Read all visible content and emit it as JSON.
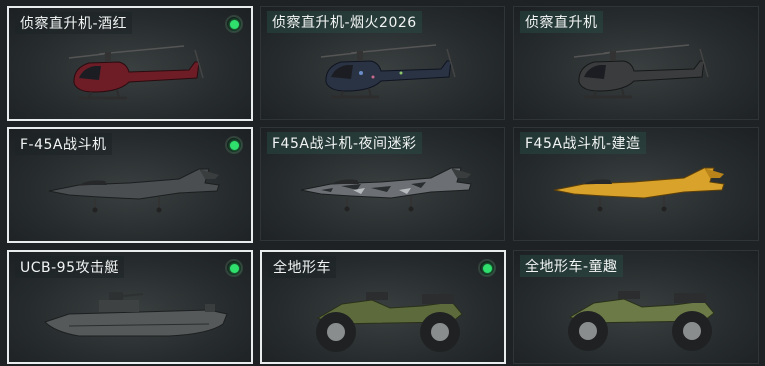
{
  "items": [
    {
      "label": "侦察直升机-酒红",
      "equipped": true,
      "selected": true,
      "kind": "helicopter",
      "color": "#6e1c26"
    },
    {
      "label": "侦察直升机-烟火2026",
      "equipped": false,
      "selected": false,
      "kind": "helicopter",
      "color": "#2a3344"
    },
    {
      "label": "侦察直升机",
      "equipped": false,
      "selected": false,
      "kind": "helicopter",
      "color": "#3a3c3d"
    },
    {
      "label": "F-45A战斗机",
      "equipped": true,
      "selected": true,
      "kind": "jet",
      "color": "#4a4e50"
    },
    {
      "label": "F45A战斗机-夜间迷彩",
      "equipped": false,
      "selected": false,
      "kind": "jet",
      "color": "#6c7074"
    },
    {
      "label": "F45A战斗机-建造",
      "equipped": false,
      "selected": false,
      "kind": "jet",
      "color": "#d9a22a"
    },
    {
      "label": "UCB-95攻击艇",
      "equipped": true,
      "selected": true,
      "kind": "boat",
      "color": "#55595a"
    },
    {
      "label": "全地形车",
      "equipped": true,
      "selected": true,
      "kind": "atv",
      "color": "#5d6b3c"
    },
    {
      "label": "全地形车-童趣",
      "equipped": false,
      "selected": false,
      "kind": "atv",
      "color": "#6b7a46"
    }
  ]
}
